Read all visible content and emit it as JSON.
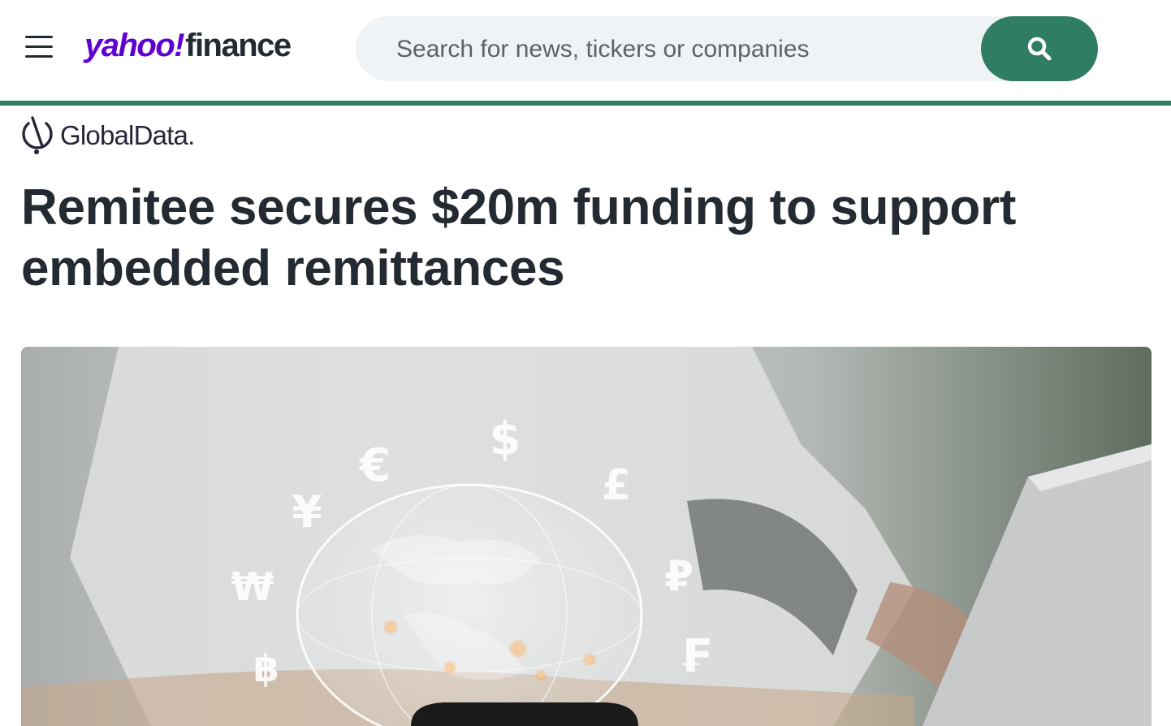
{
  "header": {
    "brand_primary": "yahoo",
    "brand_bang": "!",
    "brand_secondary": "finance",
    "menu_icon": "hamburger-menu-icon",
    "search": {
      "placeholder": "Search for news, tickers or companies",
      "value": "",
      "button_icon": "search-icon"
    }
  },
  "article": {
    "publisher": "GlobalData.",
    "title": "Remitee secures $20m funding to support embedded remittances"
  },
  "hero_image": {
    "currency_symbols": [
      "$",
      "€",
      "£",
      "¥",
      "₽",
      "₩",
      "₣",
      "฿"
    ]
  },
  "colors": {
    "brand_purple": "#6001d2",
    "accent_green": "#2e7d64",
    "text_dark": "#232a31",
    "search_bg": "#f0f3f5"
  }
}
